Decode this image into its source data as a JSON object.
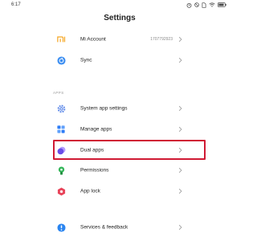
{
  "status_bar": {
    "time": "6:17"
  },
  "header": {
    "title": "Settings"
  },
  "accounts": [
    {
      "id": "mi-account",
      "label": "Mi Account",
      "value": "1707792923",
      "icon": "mi-logo-icon",
      "color": "#f5a623"
    },
    {
      "id": "sync",
      "label": "Sync",
      "value": "",
      "icon": "sync-icon",
      "color": "#3d8ff2"
    }
  ],
  "apps_section": {
    "header": "APPS",
    "items": [
      {
        "id": "system-app-settings",
        "label": "System app settings",
        "icon": "gear-icon",
        "color": "#5b87e8"
      },
      {
        "id": "manage-apps",
        "label": "Manage apps",
        "icon": "grid-icon",
        "color": "#2e7df6"
      },
      {
        "id": "dual-apps",
        "label": "Dual apps",
        "icon": "dual-apps-icon",
        "color": "#6a4de6",
        "highlighted": true
      },
      {
        "id": "permissions",
        "label": "Permissions",
        "icon": "permissions-icon",
        "color": "#35b65a"
      },
      {
        "id": "app-lock",
        "label": "App lock",
        "icon": "app-lock-icon",
        "color": "#e8445a"
      }
    ]
  },
  "more": [
    {
      "id": "services-feedback",
      "label": "Services & feedback",
      "icon": "help-icon",
      "color": "#2a85f0"
    }
  ],
  "highlight_color": "#d01a34"
}
